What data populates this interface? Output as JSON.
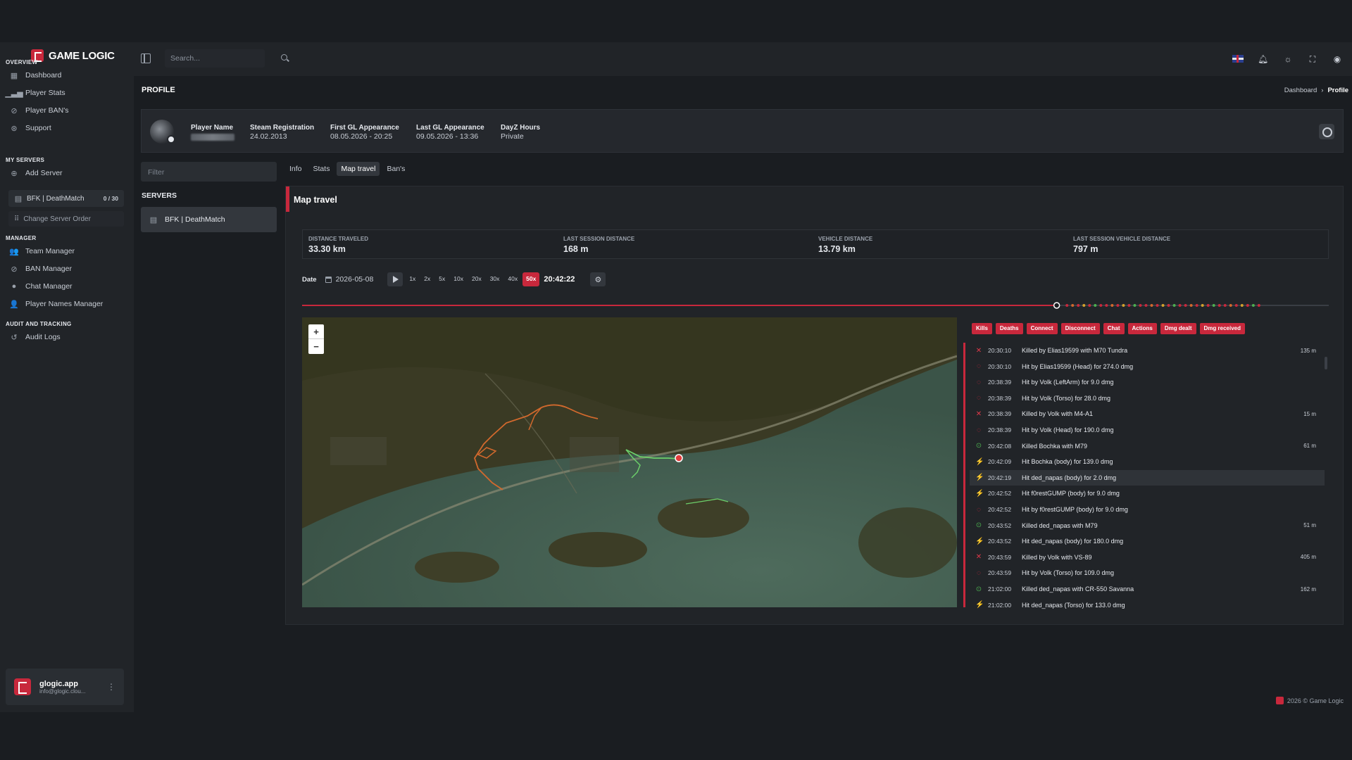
{
  "app": {
    "name": "GAME LOGIC"
  },
  "topbar": {
    "search_placeholder": "Search..."
  },
  "sidebar": {
    "overview_title": "OVERVIEW",
    "overview_items": [
      {
        "label": "Dashboard",
        "icon": "dashboard-icon"
      },
      {
        "label": "Player Stats",
        "icon": "chart-icon"
      },
      {
        "label": "Player BAN's",
        "icon": "ban-icon"
      },
      {
        "label": "Support",
        "icon": "support-icon"
      }
    ],
    "servers_title": "MY SERVERS",
    "add_server": "Add Server",
    "server": {
      "name": "BFK | DeathMatch",
      "count": "0 / 30"
    },
    "change_order": "Change Server Order",
    "manager_title": "MANAGER",
    "manager_items": [
      {
        "label": "Team Manager",
        "icon": "team-icon"
      },
      {
        "label": "BAN Manager",
        "icon": "ban-icon"
      },
      {
        "label": "Chat Manager",
        "icon": "chat-icon"
      },
      {
        "label": "Player Names Manager",
        "icon": "user-icon"
      }
    ],
    "audit_title": "AUDIT AND TRACKING",
    "audit_items": [
      {
        "label": "Audit Logs",
        "icon": "history-icon"
      }
    ],
    "user": {
      "name": "glogic.app",
      "email": "info@glogic.clou..."
    }
  },
  "page": {
    "title": "PROFILE",
    "breadcrumb": [
      "Dashboard",
      "Profile"
    ]
  },
  "profile": {
    "player_name_label": "Player Name",
    "steam_reg_label": "Steam Registration",
    "steam_reg_value": "24.02.2013",
    "first_gl_label": "First GL Appearance",
    "first_gl_value": "08.05.2026 - 20:25",
    "last_gl_label": "Last GL Appearance",
    "last_gl_value": "09.05.2026 - 13:36",
    "dayz_label": "DayZ Hours",
    "dayz_value": "Private"
  },
  "left": {
    "filter_placeholder": "Filter",
    "servers_title": "SERVERS",
    "server_name": "BFK | DeathMatch"
  },
  "tabs": [
    "Info",
    "Stats",
    "Map travel",
    "Ban's"
  ],
  "active_tab": "Map travel",
  "map_travel": {
    "title": "Map travel",
    "stats": [
      {
        "label": "DISTANCE TRAVELED",
        "value": "33.30 km"
      },
      {
        "label": "LAST SESSION DISTANCE",
        "value": "168 m"
      },
      {
        "label": "VEHICLE DISTANCE",
        "value": "13.79 km"
      },
      {
        "label": "LAST SESSION VEHICLE DISTANCE",
        "value": "797 m"
      }
    ],
    "date_label": "Date",
    "date_value": "2026-05-08",
    "speeds": [
      "1x",
      "2x",
      "5x",
      "10x",
      "20x",
      "30x",
      "40x",
      "50x"
    ],
    "active_speed": "50x",
    "time": "20:42:22",
    "timeline_progress": 0.735,
    "zoom_in": "+",
    "zoom_out": "−",
    "filters": [
      "Kills",
      "Deaths",
      "Connect",
      "Disconnect",
      "Chat",
      "Actions",
      "Dmg dealt",
      "Dmg received"
    ],
    "events": [
      {
        "time": "20:30:10",
        "text": "Killed by Elias19599 with M70 Tundra",
        "dist": "135 m",
        "type": "death"
      },
      {
        "time": "20:30:10",
        "text": "Hit by Elias19599 (Head) for 274.0 dmg",
        "dist": "",
        "type": "recv"
      },
      {
        "time": "20:38:39",
        "text": "Hit by Volk (LeftArm) for 9.0 dmg",
        "dist": "",
        "type": "recv"
      },
      {
        "time": "20:38:39",
        "text": "Hit by Volk (Torso) for 28.0 dmg",
        "dist": "",
        "type": "recv"
      },
      {
        "time": "20:38:39",
        "text": "Killed by Volk with M4-A1",
        "dist": "15 m",
        "type": "death"
      },
      {
        "time": "20:38:39",
        "text": "Hit by Volk (Head) for 190.0 dmg",
        "dist": "",
        "type": "recv"
      },
      {
        "time": "20:42:08",
        "text": "Killed Bochka with M79",
        "dist": "61 m",
        "type": "kill"
      },
      {
        "time": "20:42:09",
        "text": "Hit Bochka (body) for 139.0 dmg",
        "dist": "",
        "type": "dealt"
      },
      {
        "time": "20:42:19",
        "text": "Hit ded_napas (body) for 2.0 dmg",
        "dist": "",
        "type": "dealt",
        "highlight": true
      },
      {
        "time": "20:42:52",
        "text": "Hit f0restGUMP (body) for 9.0 dmg",
        "dist": "",
        "type": "dealt"
      },
      {
        "time": "20:42:52",
        "text": "Hit by f0restGUMP (body) for 9.0 dmg",
        "dist": "",
        "type": "recv"
      },
      {
        "time": "20:43:52",
        "text": "Killed ded_napas with M79",
        "dist": "51 m",
        "type": "kill"
      },
      {
        "time": "20:43:52",
        "text": "Hit ded_napas (body) for 180.0 dmg",
        "dist": "",
        "type": "dealt"
      },
      {
        "time": "20:43:59",
        "text": "Killed by Volk with VS-89",
        "dist": "405 m",
        "type": "death"
      },
      {
        "time": "20:43:59",
        "text": "Hit by Volk (Torso) for 109.0 dmg",
        "dist": "",
        "type": "recv"
      },
      {
        "time": "21:02:00",
        "text": "Killed ded_napas with CR-550 Savanna",
        "dist": "162 m",
        "type": "kill"
      },
      {
        "time": "21:02:00",
        "text": "Hit ded_napas (Torso) for 133.0 dmg",
        "dist": "",
        "type": "dealt"
      }
    ]
  },
  "footer": "2026 © Game Logic",
  "colors": {
    "accent": "#c8283c",
    "bg": "#1a1d21",
    "panel": "#212428",
    "kill": "#4caf50",
    "path_orange": "#d2692d",
    "path_green": "#6ccf6a"
  }
}
